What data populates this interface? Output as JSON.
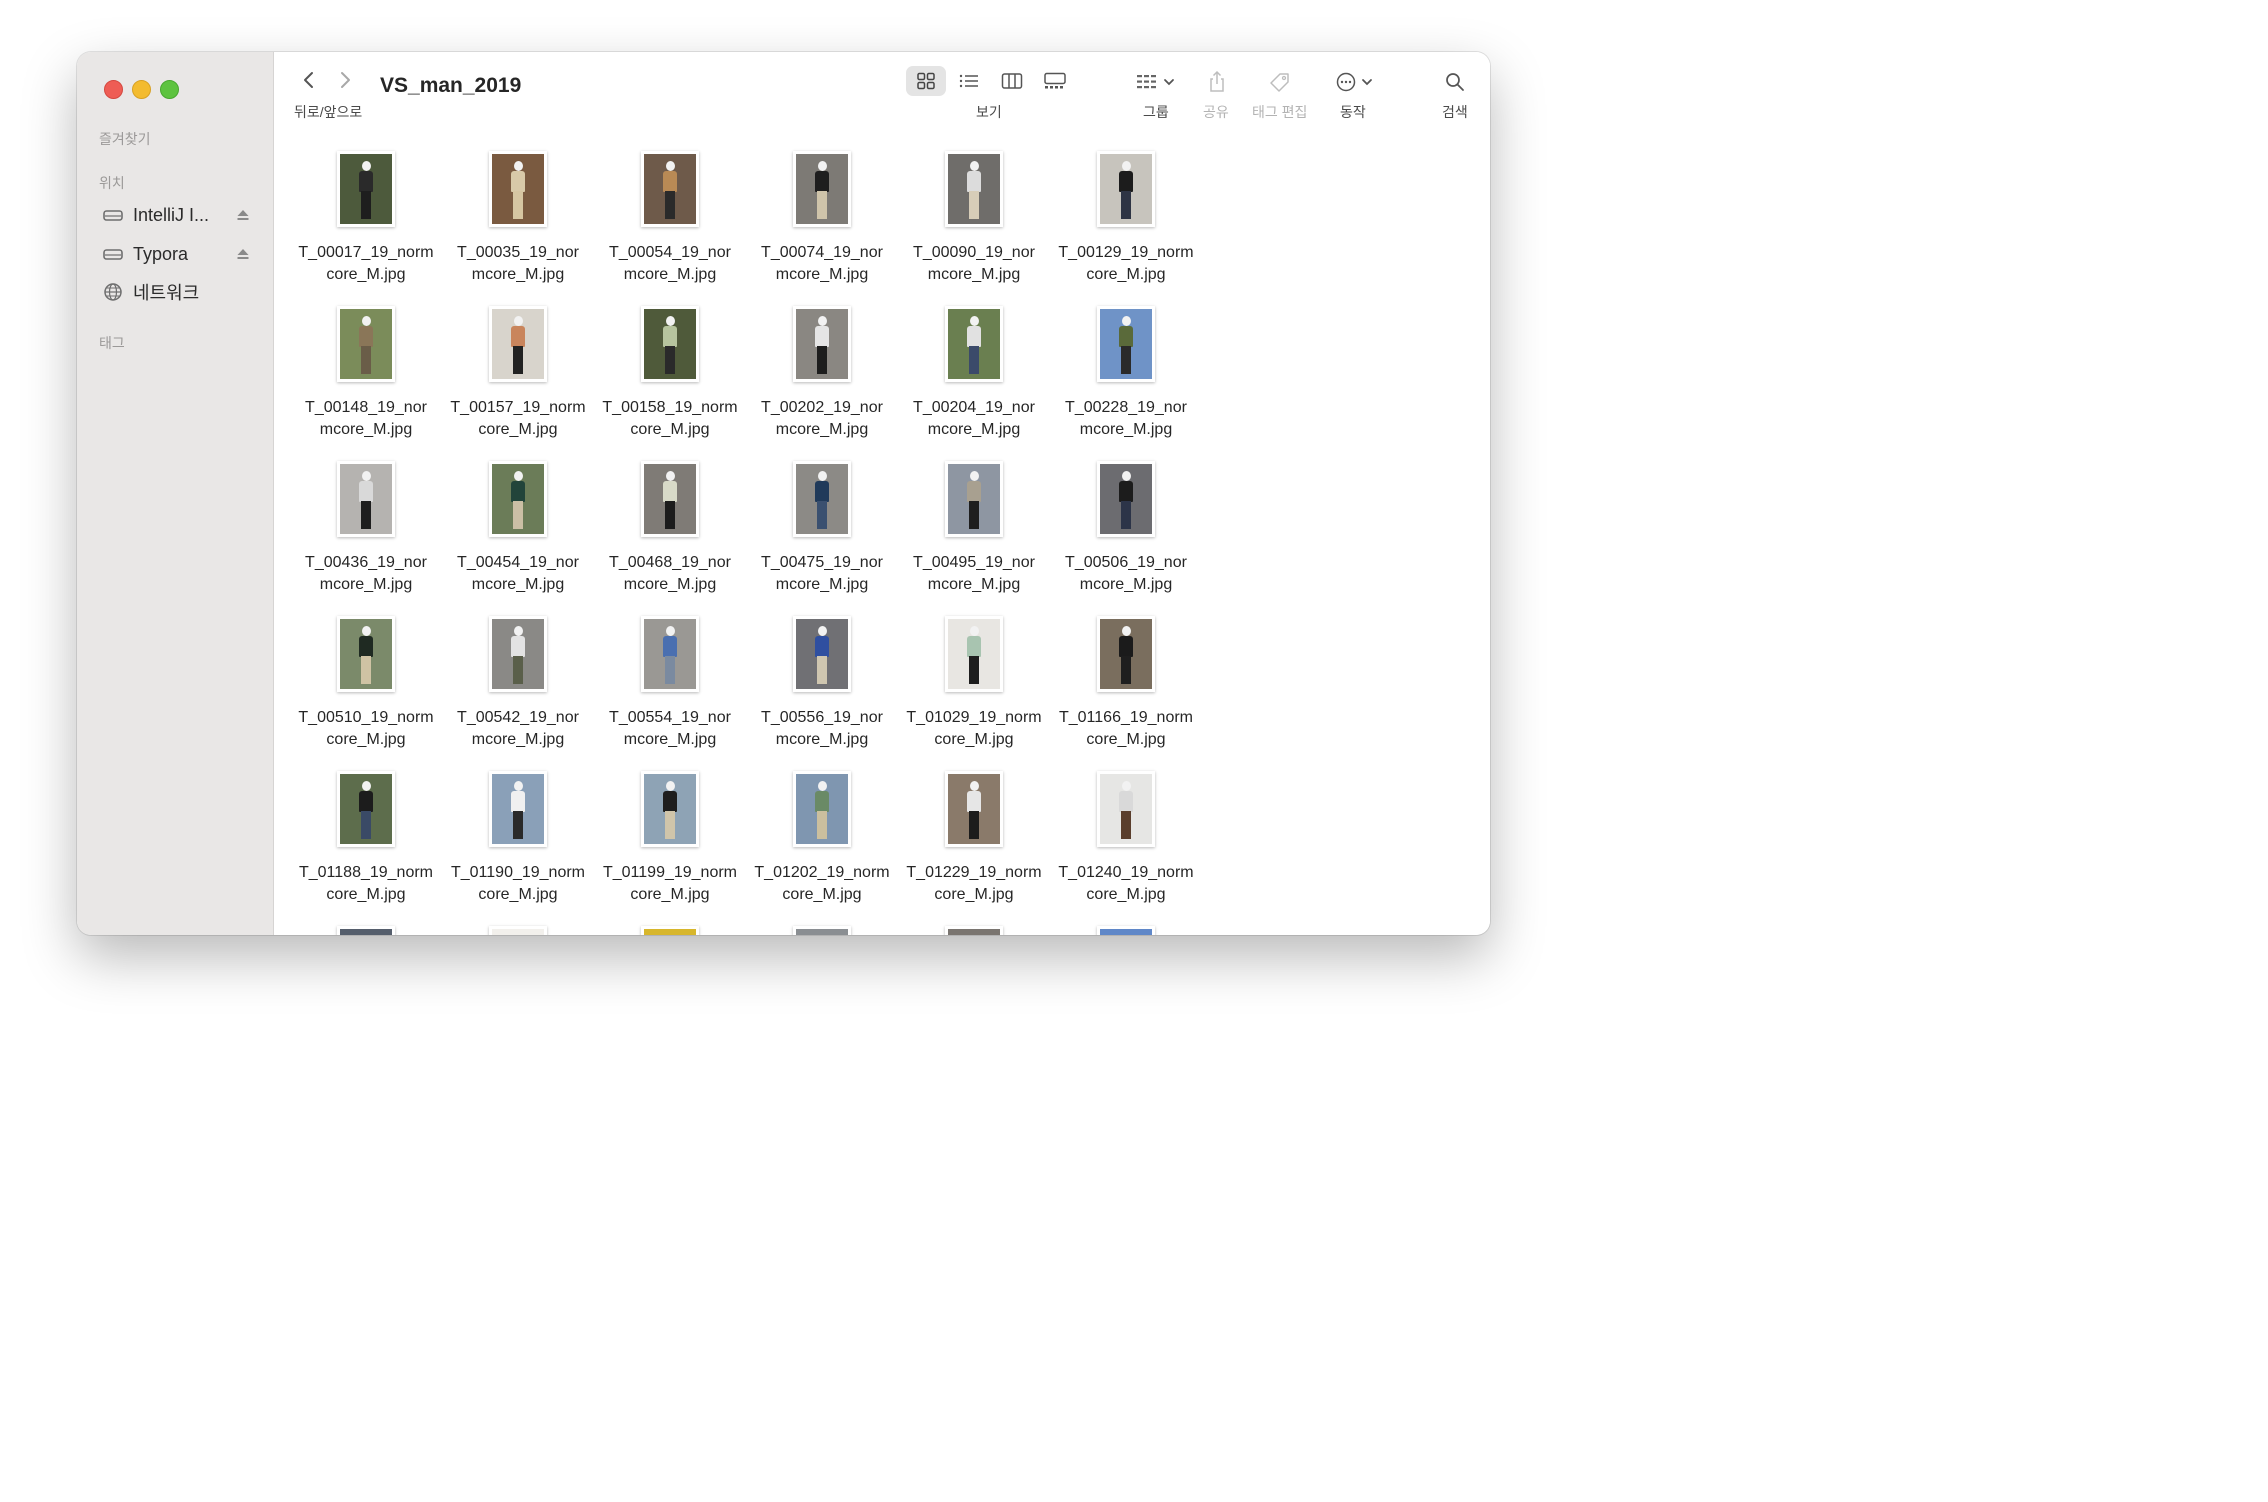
{
  "window": {
    "title": "VS_man_2019"
  },
  "toolbar": {
    "back_forward_label": "뒤로/앞으로",
    "view_label": "보기",
    "group_label": "그룹",
    "share_label": "공유",
    "tag_edit_label": "태그 편집",
    "action_label": "동작",
    "search_label": "검색"
  },
  "sidebar": {
    "favorites_header": "즐겨찾기",
    "locations_header": "위치",
    "tags_header": "태그",
    "locations": [
      {
        "label": "IntelliJ I...",
        "icon": "drive-icon",
        "ejectable": true
      },
      {
        "label": "Typora",
        "icon": "drive-icon",
        "ejectable": true
      },
      {
        "label": "네트워크",
        "icon": "network-globe-icon",
        "ejectable": false
      }
    ]
  },
  "files": [
    {
      "line1": "T_00017_19_norm",
      "line2": "core_M.jpg",
      "bg": "#4d5a3c",
      "top": "#2a2a2a",
      "bottom": "#1e1e1e"
    },
    {
      "line1": "T_00035_19_nor",
      "line2": "mcore_M.jpg",
      "bg": "#7a5a40",
      "top": "#d8c9a8",
      "bottom": "#d6c6a2"
    },
    {
      "line1": "T_00054_19_nor",
      "line2": "mcore_M.jpg",
      "bg": "#6e5a4a",
      "top": "#b98a55",
      "bottom": "#2a2a2a"
    },
    {
      "line1": "T_00074_19_nor",
      "line2": "mcore_M.jpg",
      "bg": "#7d7a75",
      "top": "#1e1e1e",
      "bottom": "#cfc4aa"
    },
    {
      "line1": "T_00090_19_nor",
      "line2": "mcore_M.jpg",
      "bg": "#6f6d6a",
      "top": "#dcdcdc",
      "bottom": "#d7cdb8"
    },
    {
      "line1": "T_00129_19_norm",
      "line2": "core_M.jpg",
      "bg": "#c7c4bd",
      "top": "#1c1c1c",
      "bottom": "#2e3444"
    },
    {
      "line1": "T_00148_19_nor",
      "line2": "mcore_M.jpg",
      "bg": "#7b8c5a",
      "top": "#8a7658",
      "bottom": "#6a5d48"
    },
    {
      "line1": "T_00157_19_norm",
      "line2": "core_M.jpg",
      "bg": "#d8d4cc",
      "top": "#c9855c",
      "bottom": "#222222"
    },
    {
      "line1": "T_00158_19_norm",
      "line2": "core_M.jpg",
      "bg": "#4f5a3a",
      "top": "#b6c49e",
      "bottom": "#2a2a2a"
    },
    {
      "line1": "T_00202_19_nor",
      "line2": "mcore_M.jpg",
      "bg": "#8a8782",
      "top": "#e5e5e5",
      "bottom": "#1d1d1d"
    },
    {
      "line1": "T_00204_19_nor",
      "line2": "mcore_M.jpg",
      "bg": "#6a7f50",
      "top": "#e1e1e1",
      "bottom": "#3b4a6a"
    },
    {
      "line1": "T_00228_19_nor",
      "line2": "mcore_M.jpg",
      "bg": "#6f93c7",
      "top": "#5a6a3a",
      "bottom": "#2a2a2a"
    },
    {
      "line1": "T_00436_19_nor",
      "line2": "mcore_M.jpg",
      "bg": "#b5b3b0",
      "top": "#d9d9d9",
      "bottom": "#1e1e1e"
    },
    {
      "line1": "T_00454_19_nor",
      "line2": "mcore_M.jpg",
      "bg": "#6b7c58",
      "top": "#22443a",
      "bottom": "#cbbfa5"
    },
    {
      "line1": "T_00468_19_nor",
      "line2": "mcore_M.jpg",
      "bg": "#7f7b76",
      "top": "#d8dac8",
      "bottom": "#1c1c1c"
    },
    {
      "line1": "T_00475_19_nor",
      "line2": "mcore_M.jpg",
      "bg": "#8c8a86",
      "top": "#203a5a",
      "bottom": "#3a5070"
    },
    {
      "line1": "T_00495_19_nor",
      "line2": "mcore_M.jpg",
      "bg": "#8e96a2",
      "top": "#a8a090",
      "bottom": "#1e1e1e"
    },
    {
      "line1": "T_00506_19_nor",
      "line2": "mcore_M.jpg",
      "bg": "#6c6c70",
      "top": "#1c1c1c",
      "bottom": "#2c3448"
    },
    {
      "line1": "T_00510_19_norm",
      "line2": "core_M.jpg",
      "bg": "#7b8a6a",
      "top": "#1f2a22",
      "bottom": "#cfc3a4"
    },
    {
      "line1": "T_00542_19_nor",
      "line2": "mcore_M.jpg",
      "bg": "#8a8986",
      "top": "#e3e3e3",
      "bottom": "#5a5f4a"
    },
    {
      "line1": "T_00554_19_nor",
      "line2": "mcore_M.jpg",
      "bg": "#9a9894",
      "top": "#4a6fb0",
      "bottom": "#7a8aa0"
    },
    {
      "line1": "T_00556_19_nor",
      "line2": "mcore_M.jpg",
      "bg": "#707074",
      "top": "#2f4fa0",
      "bottom": "#cfc6b0"
    },
    {
      "line1": "T_01029_19_norm",
      "line2": "core_M.jpg",
      "bg": "#e8e6e2",
      "top": "#a8c4b0",
      "bottom": "#1e1e1e"
    },
    {
      "line1": "T_01166_19_norm",
      "line2": "core_M.jpg",
      "bg": "#7a6e5e",
      "top": "#1b1b1b",
      "bottom": "#1e1e1e"
    },
    {
      "line1": "T_01188_19_norm",
      "line2": "core_M.jpg",
      "bg": "#5d6d4c",
      "top": "#1c1c1c",
      "bottom": "#3a4a66"
    },
    {
      "line1": "T_01190_19_norm",
      "line2": "core_M.jpg",
      "bg": "#8aa0b8",
      "top": "#f0f0f0",
      "bottom": "#2a2a2a"
    },
    {
      "line1": "T_01199_19_norm",
      "line2": "core_M.jpg",
      "bg": "#8ea3b5",
      "top": "#1e1e1e",
      "bottom": "#d0c5aa"
    },
    {
      "line1": "T_01202_19_norm",
      "line2": "core_M.jpg",
      "bg": "#7f96b0",
      "top": "#6a8a66",
      "bottom": "#cbbf9e"
    },
    {
      "line1": "T_01229_19_norm",
      "line2": "core_M.jpg",
      "bg": "#8a7a6a",
      "top": "#e6e6e6",
      "bottom": "#1c1c1c"
    },
    {
      "line1": "T_01240_19_norm",
      "line2": "core_M.jpg",
      "bg": "#e6e6e4",
      "top": "#d9d9d9",
      "bottom": "#5a3e2c"
    },
    {
      "line1": "",
      "line2": "",
      "bg": "#555e6c",
      "top": "#444444",
      "bottom": "#444444"
    },
    {
      "line1": "",
      "line2": "",
      "bg": "#f2f0ec",
      "top": "#eeeeee",
      "bottom": "#eeeeee"
    },
    {
      "line1": "",
      "line2": "",
      "bg": "#d7b62c",
      "top": "#222222",
      "bottom": "#222222"
    },
    {
      "line1": "",
      "line2": "",
      "bg": "#8a8e92",
      "top": "#666666",
      "bottom": "#666666"
    },
    {
      "line1": "",
      "line2": "",
      "bg": "#7a7570",
      "top": "#555555",
      "bottom": "#555555"
    },
    {
      "line1": "",
      "line2": "",
      "bg": "#5f87c8",
      "top": "#4a6a9a",
      "bottom": "#4a6a9a"
    }
  ]
}
